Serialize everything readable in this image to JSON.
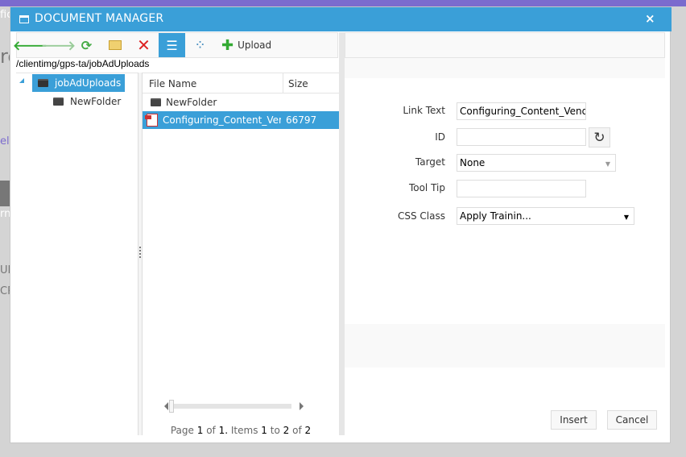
{
  "background": {
    "fragments": [
      "fic",
      "re",
      "eli",
      "rn",
      "UI'",
      "CRI"
    ]
  },
  "dialog": {
    "title": "DOCUMENT MANAGER",
    "close_label": "×"
  },
  "toolbar": {
    "buttons": [
      {
        "icon": "back-arrow-icon"
      },
      {
        "icon": "forward-arrow-icon"
      },
      {
        "icon": "refresh-icon"
      },
      {
        "icon": "new-folder-icon"
      },
      {
        "icon": "delete-icon"
      },
      {
        "icon": "list-view-icon",
        "selected": true
      },
      {
        "icon": "thumbnail-view-icon"
      }
    ],
    "upload_label": "Upload"
  },
  "path": "/clientimg/gps-ta/jobAdUploads",
  "tree": {
    "root": "jobAdUploads",
    "children": [
      "NewFolder"
    ]
  },
  "grid": {
    "columns": [
      "File Name",
      "Size"
    ],
    "rows": [
      {
        "name": "NewFolder",
        "size": "",
        "type": "folder"
      },
      {
        "name": "Configuring_Content_Vendor",
        "size": "66797",
        "type": "pdf",
        "selected": true
      }
    ]
  },
  "pager": {
    "page_word": "Page",
    "page": "1",
    "of_word": "of",
    "pages": "1.",
    "items_word": "Items",
    "from": "1",
    "to_word": "to",
    "to": "2",
    "of2": "of",
    "total": "2"
  },
  "form": {
    "link_text_label": "Link Text",
    "link_text_value": "Configuring_Content_Vendor",
    "id_label": "ID",
    "id_value": "",
    "target_label": "Target",
    "target_value": "None",
    "tooltip_label": "Tool Tip",
    "tooltip_value": "",
    "css_label": "CSS Class",
    "css_value": "Apply Trainin..."
  },
  "actions": {
    "insert": "Insert",
    "cancel": "Cancel"
  },
  "colors": {
    "accent": "#3a9fd8",
    "header_purple": "#7b6bce"
  }
}
